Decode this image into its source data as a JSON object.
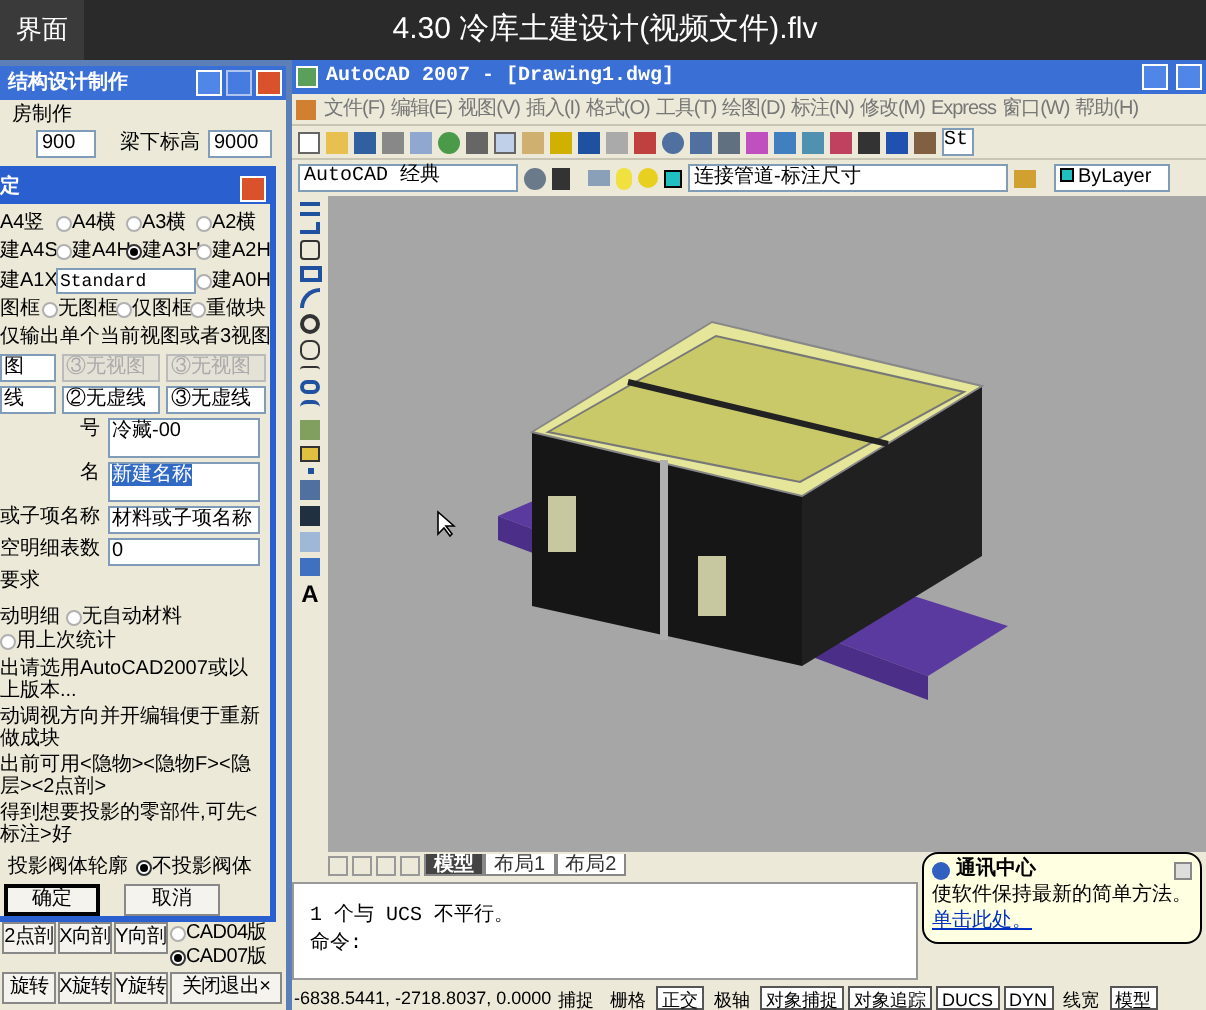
{
  "player": {
    "tab": "界面",
    "title": "4.30 冷库土建设计(视频文件).flv"
  },
  "structure_window": {
    "title": "结构设计制作",
    "group_label": "房制作",
    "value_1": "900",
    "label": "梁下标高",
    "value_2": "9000",
    "buttons": [
      {
        "label": "2点剖"
      },
      {
        "label": "X向剖"
      },
      {
        "label": "Y向剖"
      },
      {
        "label": "旋转"
      },
      {
        "label": "X旋转"
      },
      {
        "label": "Y旋转"
      },
      {
        "label": "关闭退出×"
      }
    ],
    "version_options": [
      {
        "label": "CAD04版",
        "selected": false
      },
      {
        "label": "CAD07版",
        "selected": true
      }
    ]
  },
  "dialog": {
    "title": "定",
    "paper_rows": [
      [
        {
          "kind": "label",
          "label": "A4竖"
        },
        {
          "kind": "radio",
          "label": "A4横",
          "selected": false
        },
        {
          "kind": "radio",
          "label": "A3横",
          "selected": false
        },
        {
          "kind": "radio",
          "label": "A2横",
          "selected": false
        }
      ],
      [
        {
          "kind": "label",
          "label": "建A4S"
        },
        {
          "kind": "radio",
          "label": "建A4H",
          "selected": false
        },
        {
          "kind": "radio",
          "label": "建A3H",
          "selected": true
        },
        {
          "kind": "radio",
          "label": "建A2H",
          "selected": false
        }
      ],
      [
        {
          "kind": "label",
          "label": "建A1X"
        },
        {
          "kind": "dropdown",
          "value": "Standard"
        },
        {
          "kind": "radio",
          "label": "建A0H",
          "selected": false
        }
      ]
    ],
    "frame_options": [
      {
        "kind": "label",
        "label": "图框"
      },
      {
        "kind": "radio",
        "label": "无图框",
        "selected": false
      },
      {
        "kind": "radio",
        "label": "仅图框",
        "selected": false
      },
      {
        "kind": "radio",
        "label": "重做块",
        "selected": false
      }
    ],
    "view_caption": "仅输出单个当前视图或者3视图",
    "view_dropdowns": [
      [
        {
          "value": "图",
          "disabled": false
        },
        {
          "value": "③无视图",
          "disabled": true
        },
        {
          "value": "③无视图",
          "disabled": true
        }
      ],
      [
        {
          "value": "线",
          "disabled": false
        },
        {
          "value": "②无虚线",
          "disabled": false
        },
        {
          "value": "③无虚线",
          "disabled": false
        }
      ]
    ],
    "fields": [
      {
        "label": "号",
        "value": "冷藏-00",
        "kind": "multiline",
        "highlighted": false
      },
      {
        "label": "名",
        "value": "新建名称",
        "kind": "multiline",
        "highlighted": true
      },
      {
        "label": "或子项名称",
        "value": "材料或子项名称",
        "kind": "single",
        "highlighted": false
      },
      {
        "label": "空明细表数",
        "value": "0",
        "kind": "single",
        "highlighted": false
      }
    ],
    "requirement_label": "要求",
    "material_options": [
      {
        "kind": "label",
        "label": "动明细"
      },
      {
        "kind": "radio",
        "label": "无自动材料",
        "selected": false
      },
      {
        "kind": "radio",
        "label": "用上次统计",
        "selected": false
      }
    ],
    "notes": [
      "出请选用AutoCAD2007或以上版本...",
      "动调视方向并开编辑便于重新做成块",
      "出前可用<隐物><隐物F><隐层><2点剖>",
      "得到想要投影的零部件,可先<标注>好"
    ],
    "projection_options": [
      {
        "kind": "label",
        "label": "投影阀体轮廓"
      },
      {
        "kind": "radio",
        "label": "不投影阀体",
        "selected": true
      }
    ],
    "buttons": [
      "确定",
      "取消"
    ]
  },
  "acad": {
    "title": "AutoCAD 2007 - [Drawing1.dwg]",
    "menus": [
      "文件(F)",
      "编辑(E)",
      "视图(V)",
      "插入(I)",
      "格式(O)",
      "工具(T)",
      "绘图(D)",
      "标注(N)",
      "修改(M)",
      "Express",
      "窗口(W)",
      "帮助(H)"
    ],
    "style_field": "St",
    "workspace": "AutoCAD 经典",
    "layer": "连接管道-标注尺寸",
    "color_setting": "ByLayer",
    "text_tool": "A",
    "layout_tabs": [
      {
        "label": "模型",
        "selected": true
      },
      {
        "label": "布局1",
        "selected": false
      },
      {
        "label": "布局2",
        "selected": false
      }
    ],
    "command_lines": [
      "1 个与 UCS 不平行。",
      "命令:"
    ],
    "coordinates": "-6838.5441, -2718.8037, 0.0000",
    "status_toggles": [
      {
        "label": "捕捉",
        "on": false
      },
      {
        "label": "栅格",
        "on": false
      },
      {
        "label": "正交",
        "on": true
      },
      {
        "label": "极轴",
        "on": false
      },
      {
        "label": "对象捕捉",
        "on": true
      },
      {
        "label": "对象追踪",
        "on": true
      },
      {
        "label": "DUCS",
        "on": true
      },
      {
        "label": "DYN",
        "on": true
      },
      {
        "label": "线宽",
        "on": false
      },
      {
        "label": "模型",
        "on": true
      }
    ],
    "balloon": {
      "title": "通讯中心",
      "text": "使软件保持最新的简单方法。",
      "link": "单击此处。"
    }
  }
}
